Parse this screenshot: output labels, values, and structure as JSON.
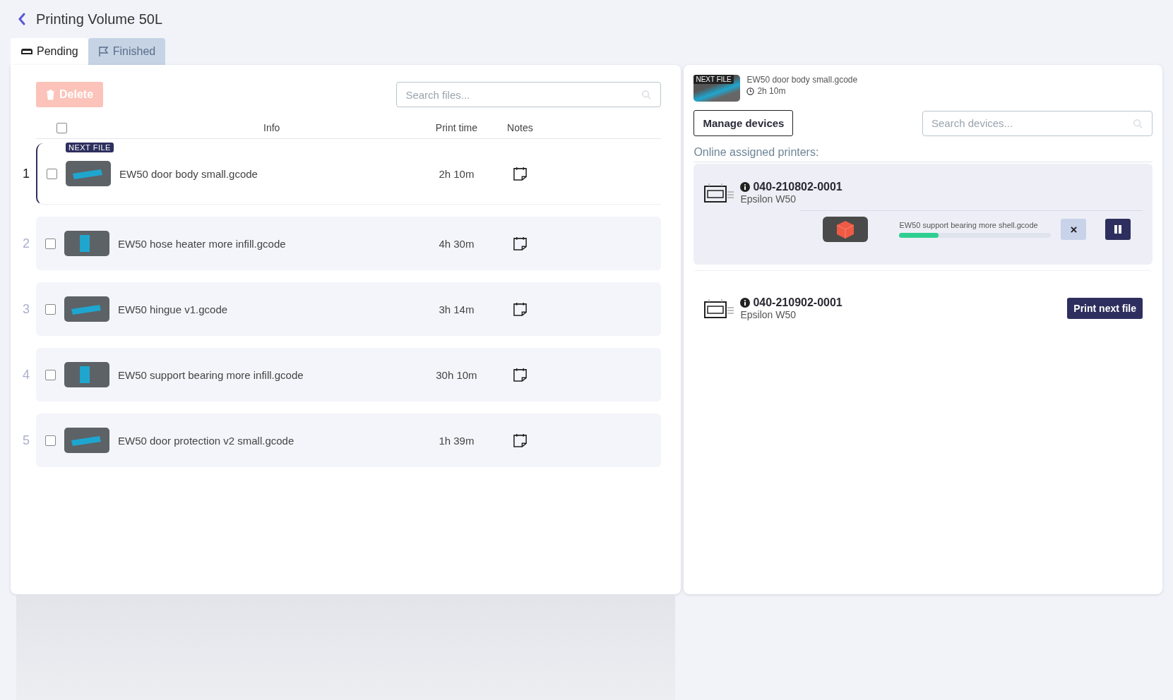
{
  "header": {
    "title": "Printing Volume 50L"
  },
  "tabs": [
    {
      "label": "Pending",
      "selected": true,
      "kind": "tray"
    },
    {
      "label": "Finished",
      "selected": false,
      "kind": "flag"
    }
  ],
  "files_panel": {
    "delete_button": {
      "label": "Delete",
      "disabled": true
    },
    "search": {
      "placeholder": "Search files..."
    },
    "select_all": {
      "checked": false
    },
    "columns": [
      "Info",
      "Print time",
      "Notes"
    ],
    "rows": [
      {
        "index": "1",
        "badge": "NEXT FILE",
        "name": "EW50 door body small.gcode",
        "print_time": "2h 10m",
        "checked": false,
        "selected": true
      },
      {
        "index": "2",
        "name": "EW50 hose heater more infill.gcode",
        "print_time": "4h 30m",
        "checked": false,
        "selected": false
      },
      {
        "index": "3",
        "name": "EW50 hingue v1.gcode",
        "print_time": "3h 14m",
        "checked": false,
        "selected": false
      },
      {
        "index": "4",
        "name": "EW50 support bearing more infill.gcode",
        "print_time": "30h 10m",
        "checked": false,
        "selected": false
      },
      {
        "index": "5",
        "name": "EW50 door protection v2 small.gcode",
        "print_time": "1h 39m",
        "checked": false,
        "selected": false
      }
    ]
  },
  "devices_panel": {
    "next_file": {
      "badge": "NEXT FILE",
      "name": "EW50 door body small.gcode",
      "time": "2h 10m"
    },
    "manage_button": "Manage devices",
    "search": {
      "placeholder": "Search devices..."
    },
    "section_label": "Online assigned printers:",
    "printers": [
      {
        "serial": "040-210802-0001",
        "model": "Epsilon W50",
        "kind": "printing",
        "job": {
          "file": "EW50 support bearing more shell.gcode",
          "level": 0.26
        }
      },
      {
        "serial": "040-210902-0001",
        "model": "Epsilon W50",
        "kind": "idle",
        "action": "Print next file"
      }
    ]
  }
}
